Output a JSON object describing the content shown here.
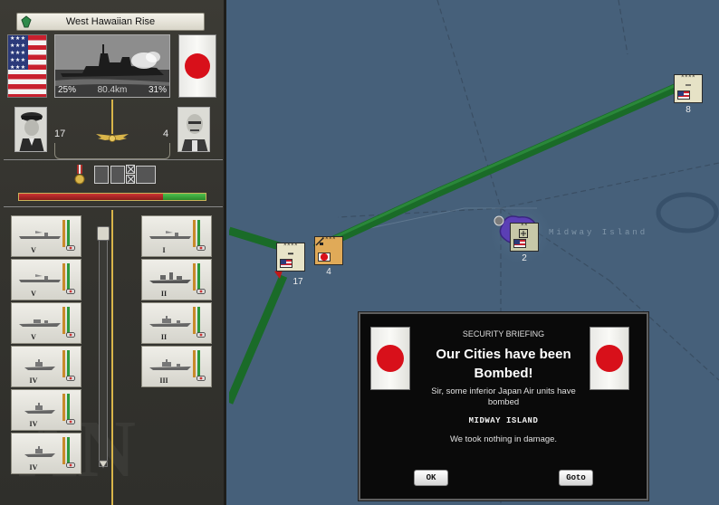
{
  "panel": {
    "region": "West Hawaiian Rise",
    "watermark": "AN",
    "battle": {
      "allied_pct": "25%",
      "distance": "80.4km",
      "axis_pct": "31%"
    },
    "allied_commander_level": "17",
    "axis_commander_level": "4",
    "strength": {
      "allied_fraction": 0.77,
      "axis_fraction": 0.23
    }
  },
  "allied_units": [
    {
      "type": "carrier",
      "rank": "V",
      "icon": "aircraft-carrier-icon"
    },
    {
      "type": "carrier",
      "rank": "V",
      "icon": "aircraft-carrier-icon"
    },
    {
      "type": "destroyer",
      "rank": "V",
      "icon": "destroyer-icon"
    },
    {
      "type": "submarine",
      "rank": "IV",
      "icon": "escort-icon"
    },
    {
      "type": "submarine",
      "rank": "IV",
      "icon": "escort-icon"
    },
    {
      "type": "submarine",
      "rank": "IV",
      "icon": "escort-icon"
    }
  ],
  "axis_units": [
    {
      "type": "carrier",
      "rank": "I",
      "icon": "aircraft-carrier-icon"
    },
    {
      "type": "battleship",
      "rank": "II",
      "icon": "battleship-icon"
    },
    {
      "type": "cruiser",
      "rank": "II",
      "icon": "cruiser-icon"
    },
    {
      "type": "cruiser",
      "rank": "III",
      "icon": "cruiser-icon"
    }
  ],
  "map": {
    "location_label": "Midway Island",
    "counters": [
      {
        "id": "allied-fleet",
        "count": "17",
        "flag": "us"
      },
      {
        "id": "axis-fleet",
        "count": "4",
        "flag": "jp"
      },
      {
        "id": "midway-garrison",
        "count": "2",
        "flag": "us"
      },
      {
        "id": "ne-fleet",
        "count": "8",
        "flag": "us"
      }
    ]
  },
  "briefing": {
    "label": "SECURITY BRIEFING",
    "title": "Our Cities have been Bombed!",
    "body": "Sir, some inferior Japan Air units have bombed",
    "target": "MIDWAY ISLAND",
    "result": "We took nothing in damage.",
    "ok_label": "OK",
    "goto_label": "Goto"
  },
  "colors": {
    "supply_line": "#1f7a2f",
    "ocean": "#46607a",
    "island": "#5b3fb5"
  }
}
